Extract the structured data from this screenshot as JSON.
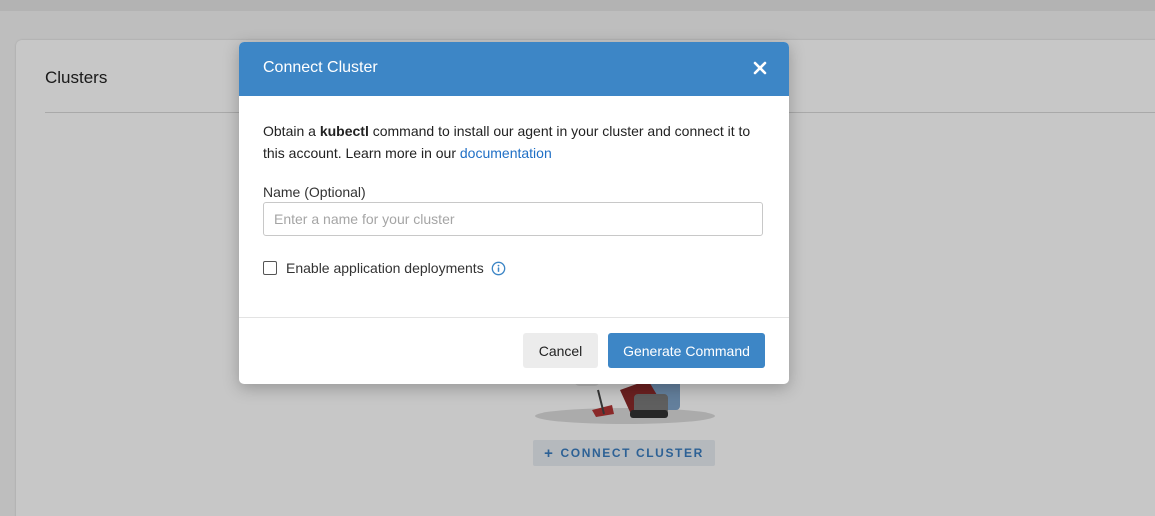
{
  "page": {
    "title": "Clusters",
    "connect_button_label": "CONNECT CLUSTER",
    "connect_button_icon": "plus-icon"
  },
  "modal": {
    "title": "Connect Cluster",
    "close_icon": "close-icon",
    "description": {
      "prefix": "Obtain a ",
      "bold": "kubectl",
      "middle": " command to install our agent in your cluster and connect it to this account. Learn more in our ",
      "link": "documentation"
    },
    "name_field": {
      "label": "Name (Optional)",
      "value": "",
      "placeholder": "Enter a name for your cluster"
    },
    "checkbox": {
      "label": "Enable application deployments",
      "checked": false,
      "info_icon": "info-icon"
    },
    "buttons": {
      "cancel": "Cancel",
      "primary": "Generate Command"
    }
  },
  "colors": {
    "header": "#3d86c6",
    "primary_button": "#3d86c6",
    "link": "#1f6fc5"
  }
}
